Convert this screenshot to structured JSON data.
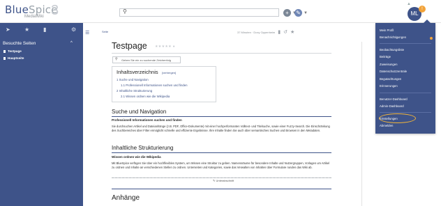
{
  "header": {
    "logo_name_a": "Blue",
    "logo_name_b": "Spice",
    "logo_sub": "MediaWiki",
    "logo_mark": "3",
    "search_placeholder": "",
    "avatar_text": "ML",
    "notif_count": "!"
  },
  "sidebar": {
    "title": "Besuchte Seiten",
    "items": [
      {
        "label": "Testpage"
      },
      {
        "label": "Hauptseite"
      }
    ]
  },
  "page": {
    "breadcrumb": "Seite",
    "meta_text": "37 Minuten · Doxy Oppenheim",
    "title": "Testpage",
    "section_search_placeholder": "Geben Sie ein zu suchende Zeichenfolg",
    "toc": {
      "title": "Inhaltsverzeichnis",
      "hide": "[verbergen]",
      "items": [
        {
          "text": "1   Suche und Navigation"
        },
        {
          "text": "1.1   Professionell Informationen suchen und finden"
        },
        {
          "text": "2   Inhaltliche Strukturierung"
        },
        {
          "text": "2.1   Wissen ordnen wie die Wikipedia"
        }
      ]
    },
    "sec1": {
      "heading": "Suche und Navigation",
      "subheading": "Professionell Informationen suchen und finden",
      "text": "Sie durchsuchen Artikel und Dateianhänge (z.B. PDF, Office-Dokumente) mit einer hochperformanten Volltext- und Titelsuche, sowie einer Fuzzy-Search. Die Einschränkung des Suchbereiches über Filter ermöglicht schnelle und effiziente Ergebnisse. Ihre Inhalte finden Sie auch über semantisches Suchen und Browsen in den Metadaten."
    },
    "sec2": {
      "heading": "Inhaltliche Strukturierung",
      "subheading": "Wissen ordnen wie die Wikipedia",
      "text": "Mit BlueSpice verfügen Sie über ein hochflexibles System, um Wissen eine Struktur zu geben. Namensräume für besondere Inhalte und Nutzergruppen, Vorlagen um Artikel zu ordnen und Inhalte an verschiedenen Stellen zu ordnen. Unterseiten und Kategorien, sowie das Verwalten von Inhalten über Formulare runden das Wiki ab."
    },
    "add_section": "Unterabschnitt",
    "sec3": {
      "heading": "Anhänge"
    }
  },
  "user_menu": {
    "items": [
      {
        "label": "Mein Profil"
      },
      {
        "label": "Benachrichtigungen"
      },
      {
        "label": "Beobachtungsliste"
      },
      {
        "label": "Beiträge"
      },
      {
        "label": "Zuweisungen"
      },
      {
        "label": "Datenschutzzentrale"
      },
      {
        "label": "Begutachtungen"
      },
      {
        "label": "Erinnerungen"
      },
      {
        "label": "Benutzer-Dashboard"
      },
      {
        "label": "Admin-Dashboard"
      },
      {
        "label": "Einstellungen"
      },
      {
        "label": "Abmelden"
      }
    ]
  },
  "colors": {
    "brand": "#3e5389",
    "accent": "#f2a33a",
    "highlight_ring": "#f2b53a"
  },
  "icons": {
    "toolbar": [
      "pin-icon",
      "tag-icon",
      "file-icon",
      "gear-icon",
      "hamburger-icon"
    ],
    "meta": [
      "comment-icon",
      "history-icon",
      "star-icon"
    ]
  }
}
